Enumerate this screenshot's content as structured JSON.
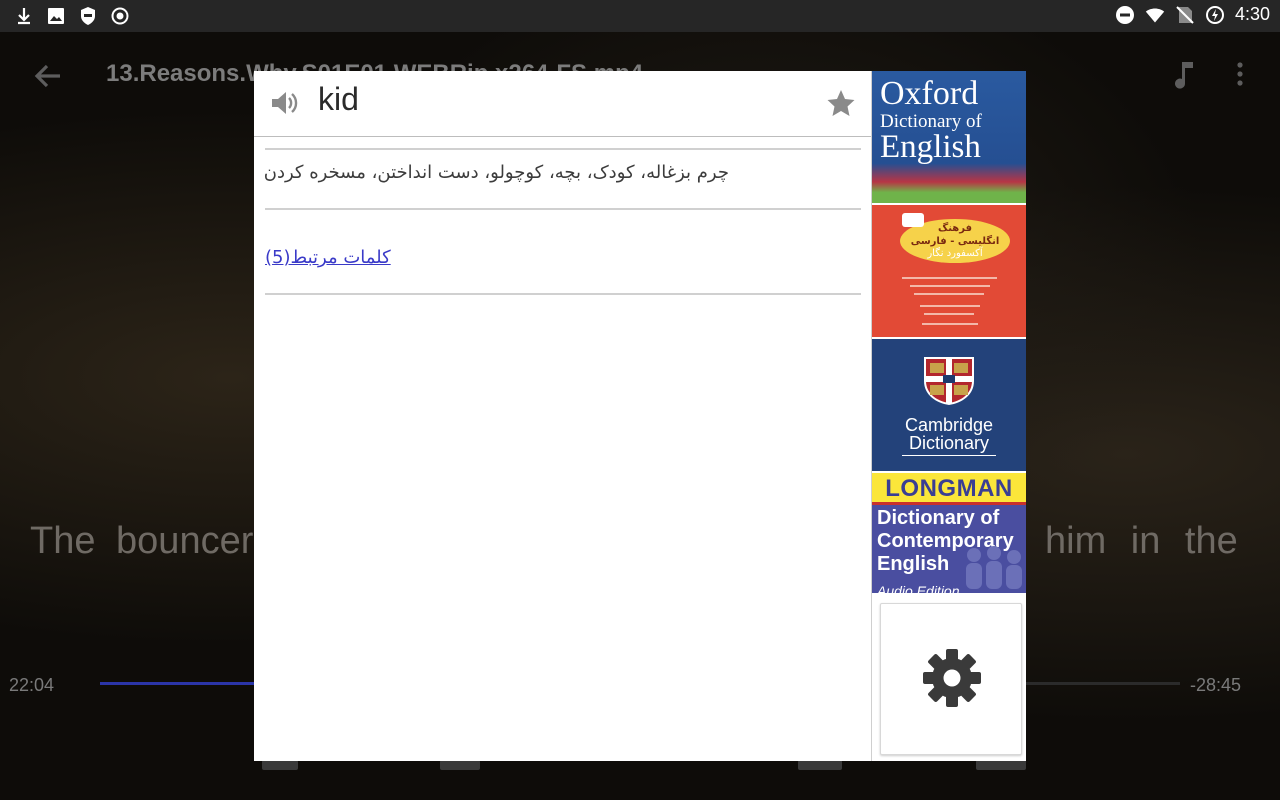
{
  "status_bar": {
    "time": "4:30",
    "left_icons": [
      "download-icon",
      "image-icon",
      "shield-icon",
      "circle-record-icon"
    ],
    "right_icons": [
      "do-not-disturb-icon",
      "wifi-icon",
      "no-sim-icon",
      "battery-charging-icon"
    ]
  },
  "video": {
    "title": "13.Reasons.Why.S01E01.WEBRip.x264-FS.mp4",
    "subtitle_left": "The  bouncer",
    "subtitle_right": "him  in  the",
    "time_current": "22:04",
    "time_remaining": "-28:45",
    "progress": 0.43
  },
  "dictionary": {
    "word": "kid",
    "meaning": "چرم بزغاله، کودک، بچه، کوچولو، دست انداختن، مسخره کردن",
    "related_link": "کلمات مرتبط(5)"
  },
  "dictionaries": {
    "oxford": {
      "line1": "Oxford",
      "line2": "Dictionary of",
      "line3": "English"
    },
    "farsi": {
      "line1": "فرهنگ",
      "line2": "انگلیسی - فارسی",
      "line3": "آکسفورد نگار"
    },
    "cambridge": {
      "line1": "Cambridge",
      "line2": "Dictionary"
    },
    "longman": {
      "brand": "LONGMAN",
      "line1": "Dictionary of",
      "line2": "Contemporary",
      "line3": "English",
      "line4": "Audio Edition"
    }
  },
  "colors": {
    "accent": "#2b35a8",
    "link": "#3a3ac8",
    "status_bar": "#262626"
  }
}
